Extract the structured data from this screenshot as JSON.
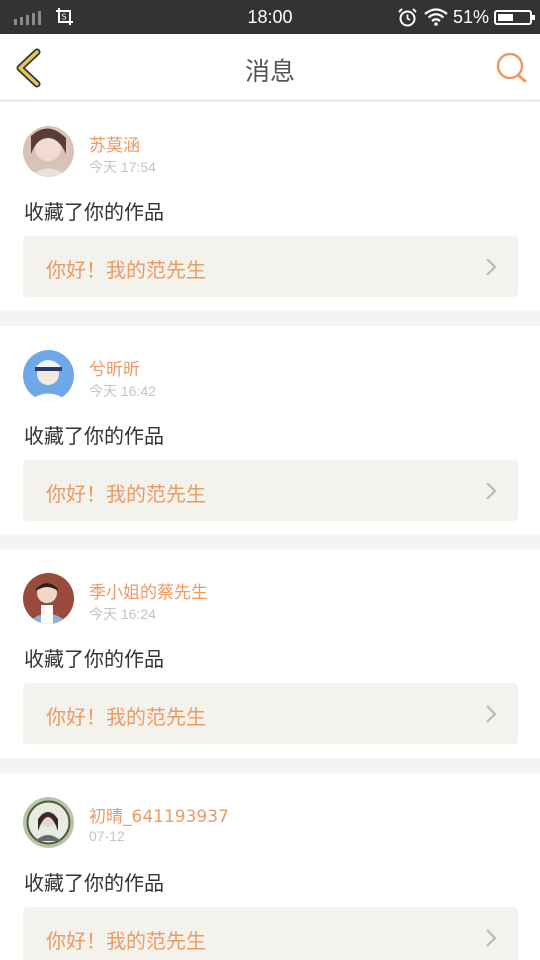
{
  "status_bar": {
    "time": "18:00",
    "battery_percent": "51%",
    "battery_level": 0.51
  },
  "nav": {
    "title": "消息",
    "back_icon": "back-arrow-icon",
    "search_icon": "search-icon"
  },
  "colors": {
    "accent": "#ec9a62",
    "nav_icon": "#e8c25a",
    "card_bg": "#f3f2ec"
  },
  "messages": [
    {
      "username": "苏莫涵",
      "time": "今天 17:54",
      "action": "收藏了你的作品",
      "work_title": "你好！我的范先生"
    },
    {
      "username": "兮昕昕",
      "time": "今天 16:42",
      "action": "收藏了你的作品",
      "work_title": "你好！我的范先生"
    },
    {
      "username": "季小姐的蔡先生",
      "time": "今天 16:24",
      "action": "收藏了你的作品",
      "work_title": "你好！我的范先生"
    },
    {
      "username": "初晴_641193937",
      "time": "07-12",
      "action": "收藏了你的作品",
      "work_title": "你好！我的范先生"
    }
  ]
}
